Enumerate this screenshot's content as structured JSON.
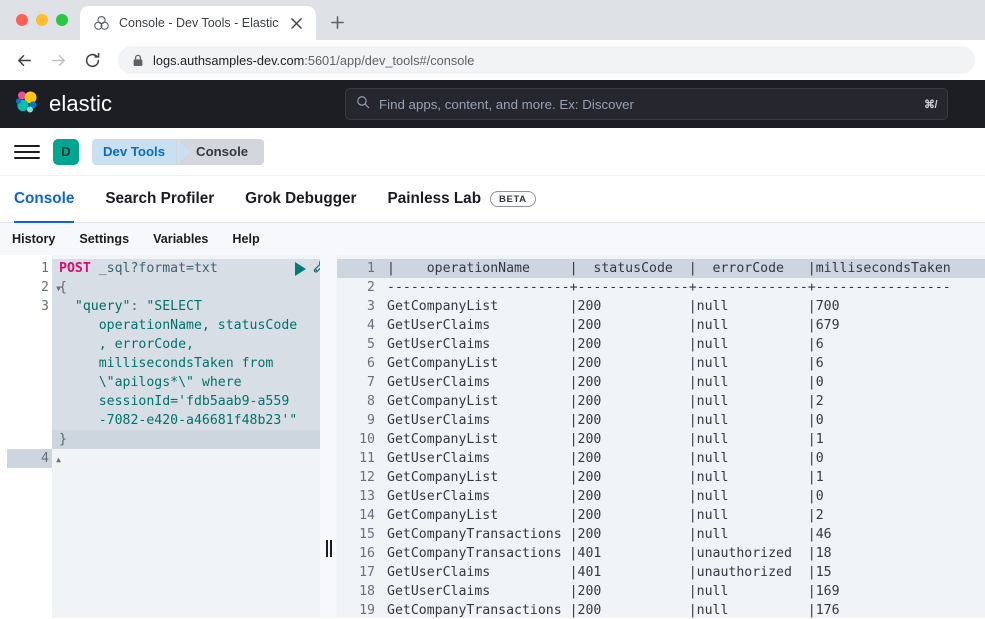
{
  "browser": {
    "tab": {
      "title": "Console - Dev Tools - Elastic",
      "favicon_icon": "elastic-logo-icon",
      "close_icon": "close-icon"
    },
    "new_tab_icon": "plus-icon",
    "nav": {
      "back_icon": "arrow-left-icon",
      "forward_icon": "arrow-right-icon",
      "reload_icon": "reload-icon"
    },
    "omnibox": {
      "lock_icon": "lock-icon",
      "host": "logs.authsamples-dev.com",
      "path": ":5601/app/dev_tools#/console"
    }
  },
  "elastic_header": {
    "logo_icon": "elastic-cluster-logo-icon",
    "brand": "elastic",
    "search": {
      "icon": "search-icon",
      "placeholder": "Find apps, content, and more. Ex: Discover",
      "shortcut": "⌘/"
    }
  },
  "breadcrumb_bar": {
    "menu_icon": "hamburger-menu-icon",
    "space_initial": "D",
    "crumbs": [
      {
        "label": "Dev Tools"
      },
      {
        "label": "Console"
      }
    ]
  },
  "app_tabs": [
    {
      "label": "Console",
      "active": true,
      "badge": ""
    },
    {
      "label": "Search Profiler",
      "active": false,
      "badge": ""
    },
    {
      "label": "Grok Debugger",
      "active": false,
      "badge": ""
    },
    {
      "label": "Painless Lab",
      "active": false,
      "badge": "BETA"
    }
  ],
  "console_toolbar": [
    {
      "label": "History"
    },
    {
      "label": "Settings"
    },
    {
      "label": "Variables"
    },
    {
      "label": "Help"
    }
  ],
  "editor": {
    "run_icon": "play-triangle-icon",
    "wrench_icon": "wrench-icon",
    "request_method": "POST",
    "request_url": " _sql?format=txt",
    "line_numbers": [
      "1",
      "2",
      "3",
      "4"
    ],
    "lines": [
      "{",
      "  \"query\": \"SELECT",
      "     operationName, statusCode",
      "     , errorCode,",
      "     millisecondsTaken from",
      "     \\\"apilogs*\\\" where",
      "     sessionId='fdb5aab9-a559",
      "     -7082-e420-a46681f48b23'\"",
      "}"
    ],
    "query_key": "\"query\"",
    "query_value_parts": [
      "\"SELECT",
      "operationName, statusCode",
      ", errorCode,",
      "millisecondsTaken from",
      "\\\"apilogs*\\\" where",
      "sessionId='fdb5aab9-a559",
      "-7082-e420-a46681f48b23'\""
    ]
  },
  "splitter": {
    "grip_icon": "drag-handle-icon"
  },
  "output": {
    "columns": [
      "operationName",
      "statusCode",
      "errorCode",
      "millisecondsTaken"
    ],
    "header_line": "  |   operationName   |  statusCode  |   errorCode  |millisecondsTaken",
    "separator_line": "-------------------+--------------+--------------+-----------------",
    "rows": [
      {
        "n": "3",
        "operationName": "GetCompanyList",
        "statusCode": "200",
        "errorCode": "null",
        "millisecondsTaken": "700"
      },
      {
        "n": "4",
        "operationName": "GetUserClaims",
        "statusCode": "200",
        "errorCode": "null",
        "millisecondsTaken": "679"
      },
      {
        "n": "5",
        "operationName": "GetUserClaims",
        "statusCode": "200",
        "errorCode": "null",
        "millisecondsTaken": "6"
      },
      {
        "n": "6",
        "operationName": "GetCompanyList",
        "statusCode": "200",
        "errorCode": "null",
        "millisecondsTaken": "6"
      },
      {
        "n": "7",
        "operationName": "GetUserClaims",
        "statusCode": "200",
        "errorCode": "null",
        "millisecondsTaken": "0"
      },
      {
        "n": "8",
        "operationName": "GetCompanyList",
        "statusCode": "200",
        "errorCode": "null",
        "millisecondsTaken": "2"
      },
      {
        "n": "9",
        "operationName": "GetUserClaims",
        "statusCode": "200",
        "errorCode": "null",
        "millisecondsTaken": "0"
      },
      {
        "n": "10",
        "operationName": "GetCompanyList",
        "statusCode": "200",
        "errorCode": "null",
        "millisecondsTaken": "1"
      },
      {
        "n": "11",
        "operationName": "GetUserClaims",
        "statusCode": "200",
        "errorCode": "null",
        "millisecondsTaken": "0"
      },
      {
        "n": "12",
        "operationName": "GetCompanyList",
        "statusCode": "200",
        "errorCode": "null",
        "millisecondsTaken": "1"
      },
      {
        "n": "13",
        "operationName": "GetUserClaims",
        "statusCode": "200",
        "errorCode": "null",
        "millisecondsTaken": "0"
      },
      {
        "n": "14",
        "operationName": "GetCompanyList",
        "statusCode": "200",
        "errorCode": "null",
        "millisecondsTaken": "2"
      },
      {
        "n": "15",
        "operationName": "GetCompanyTransactions",
        "statusCode": "200",
        "errorCode": "null",
        "millisecondsTaken": "46"
      },
      {
        "n": "16",
        "operationName": "GetCompanyTransactions",
        "statusCode": "401",
        "errorCode": "unauthorized",
        "millisecondsTaken": "18"
      },
      {
        "n": "17",
        "operationName": "GetUserClaims",
        "statusCode": "401",
        "errorCode": "unauthorized",
        "millisecondsTaken": "15"
      },
      {
        "n": "18",
        "operationName": "GetUserClaims",
        "statusCode": "200",
        "errorCode": "null",
        "millisecondsTaken": "169"
      },
      {
        "n": "19",
        "operationName": "GetCompanyTransactions",
        "statusCode": "200",
        "errorCode": "null",
        "millisecondsTaken": "176"
      }
    ]
  },
  "colors": {
    "elastic_dark": "#1d1e24",
    "accent_blue": "#0b64dd",
    "teal": "#00a68f",
    "editor_bg": "#f0f4f7",
    "active_line": "#cdd5df",
    "method_pink": "#dd0a73",
    "string_teal": "#00726b",
    "run_green": "#017d73"
  }
}
